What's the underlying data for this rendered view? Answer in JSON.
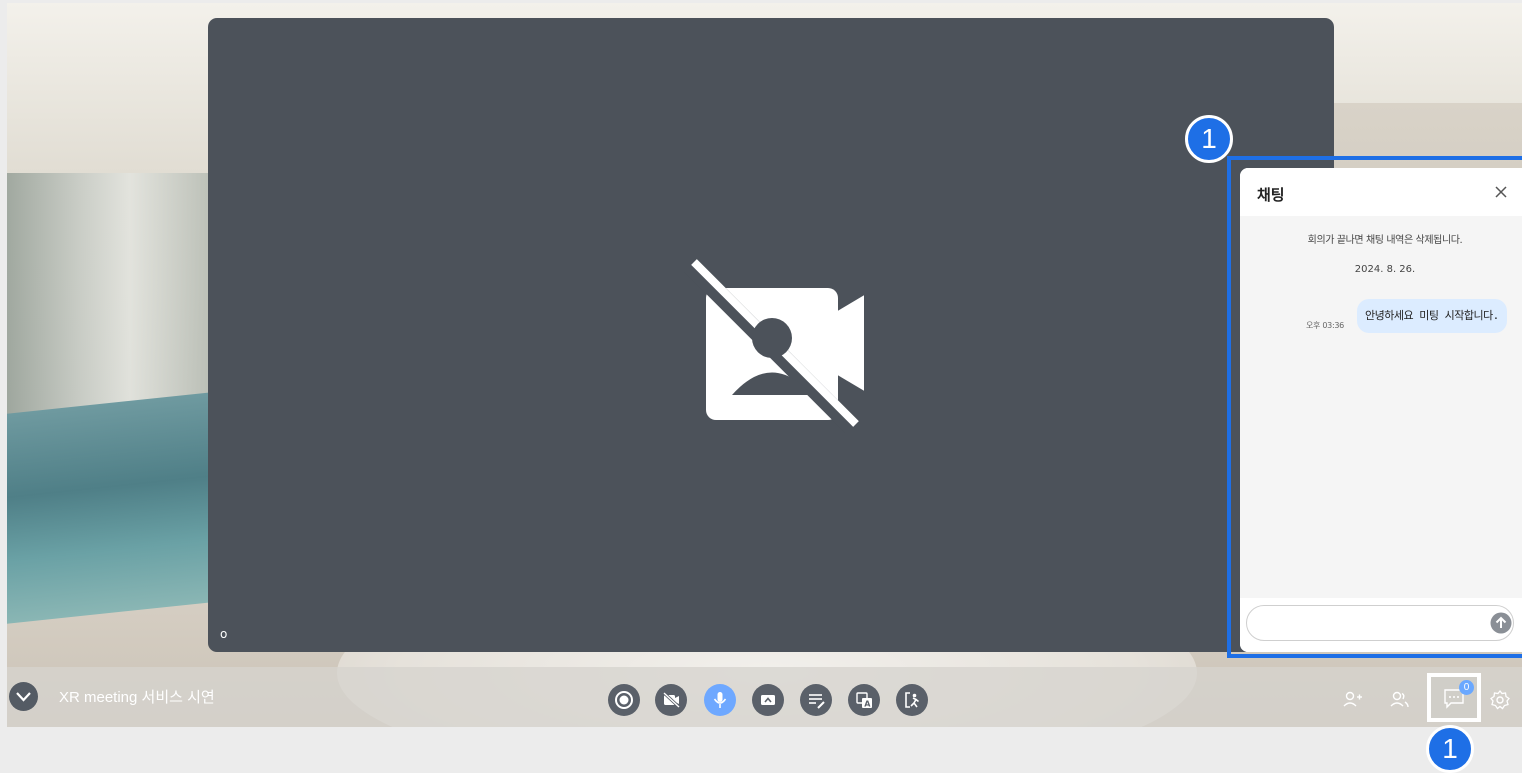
{
  "meeting": {
    "title": "XR meeting 서비스 시연",
    "participant_label": "o"
  },
  "controls": [
    {
      "name": "record-button",
      "icon": "record-icon"
    },
    {
      "name": "camera-toggle-button",
      "icon": "camera-off-icon"
    },
    {
      "name": "mic-toggle-button",
      "icon": "mic-icon",
      "active": true
    },
    {
      "name": "screen-share-button",
      "icon": "screen-share-icon"
    },
    {
      "name": "notes-button",
      "icon": "notes-edit-icon"
    },
    {
      "name": "translate-button",
      "icon": "translate-icon"
    },
    {
      "name": "leave-button",
      "icon": "exit-icon"
    }
  ],
  "right_controls": {
    "invite_icon": "add-user-icon",
    "participants_icon": "participants-icon",
    "chat_icon": "chat-icon",
    "chat_unread": "0",
    "settings_icon": "gear-icon"
  },
  "chat": {
    "title": "채팅",
    "notice": "회의가 끝나면 채팅 내역은 삭제됩니다.",
    "date": "2024. 8. 26.",
    "messages": [
      {
        "time": "오후 03:36",
        "text": "안녕하세요 미팅 시작합니다."
      }
    ],
    "input_value": "",
    "input_placeholder": ""
  },
  "markers": {
    "chat_panel": "1",
    "chat_button": "1"
  },
  "colors": {
    "accent": "#1e6fe6",
    "mic_active": "#6ea8ff",
    "video_bg": "#4c525a",
    "bubble": "#dcecff"
  }
}
